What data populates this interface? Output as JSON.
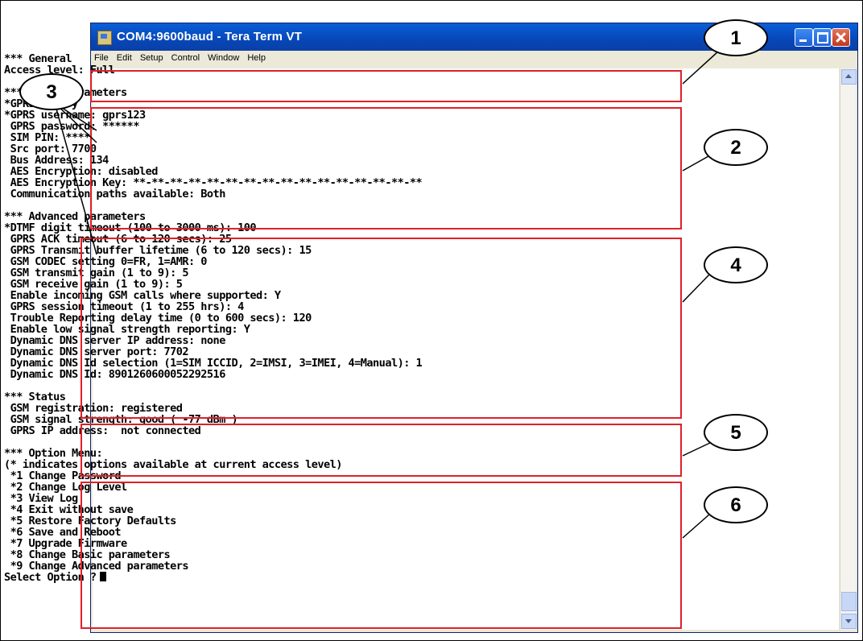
{
  "window": {
    "title": "COM4:9600baud - Tera Term VT",
    "menu": [
      "File",
      "Edit",
      "Setup",
      "Control",
      "Window",
      "Help"
    ]
  },
  "terminal": {
    "lines": [
      "*** General",
      "Access level: Full",
      "",
      "*** Basic parameters",
      "*GPRS APN: y",
      "*GPRS username: gprs123",
      " GPRS password: ******",
      " SIM PIN: ****",
      " Src port: 7700",
      " Bus Address: 134",
      " AES Encryption: disabled",
      " AES Encryption Key: **-**-**-**-**-**-**-**-**-**-**-**-**-**-**-**",
      " Communication paths available: Both",
      "",
      "*** Advanced parameters",
      "*DTMF digit timeout (100 to 3000 ms): 100",
      " GPRS ACK timeout (6 to 120 secs): 25",
      " GPRS Transmit buffer lifetime (6 to 120 secs): 15",
      " GSM CODEC setting 0=FR, 1=AMR: 0",
      " GSM transmit gain (1 to 9): 5",
      " GSM receive gain (1 to 9): 5",
      " Enable incoming GSM calls where supported: Y",
      " GPRS session timeout (1 to 255 hrs): 4",
      " Trouble Reporting delay time (0 to 600 secs): 120",
      " Enable low signal strength reporting: Y",
      " Dynamic DNS server IP address: none",
      " Dynamic DNS server port: 7702",
      " Dynamic DNS Id selection (1=SIM ICCID, 2=IMSI, 3=IMEI, 4=Manual): 1",
      " Dynamic DNS Id: 8901260600052292516",
      "",
      "*** Status",
      " GSM registration: registered",
      " GSM signal strength: good ( -77 dBm )",
      " GPRS IP address:  not connected",
      "",
      "*** Option Menu:",
      "(* indicates options available at current access level)",
      " *1 Change Password",
      " *2 Change Log Level",
      " *3 View Log",
      " *4 Exit without save",
      " *5 Restore Factory Defaults",
      " *6 Save and Reboot",
      " *7 Upgrade Firmware",
      " *8 Change Basic parameters",
      " *9 Change Advanced parameters"
    ],
    "prompt": "Select Option ?"
  },
  "callouts": [
    "1",
    "2",
    "3",
    "4",
    "5",
    "6"
  ],
  "colors": {
    "highlight_box": "#e0202a",
    "titlebar": "#0747b8"
  }
}
